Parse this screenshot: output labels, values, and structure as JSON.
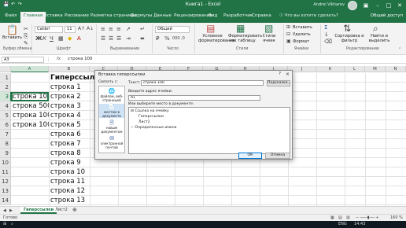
{
  "window": {
    "title": "Книга1 - Excel",
    "user": "Andrei Vikharev",
    "share": "Общий доступ"
  },
  "ribbon_tabs": [
    "Файл",
    "Главная",
    "Вставка",
    "Рисование",
    "Разметка страницы",
    "Формулы",
    "Данные",
    "Рецензирование",
    "Вид",
    "Разработчик",
    "Справка"
  ],
  "tell_me": "Что вы хотите сделать?",
  "ribbon": {
    "paste": "Вставить",
    "font_name": "Calibri",
    "font_size": "11",
    "number_format": "Общий",
    "conditional_formatting": "Условное форматирование",
    "format_as_table": "Форматировать как таблицу",
    "cell_styles": "Стили ячеек",
    "insert": "Вставить",
    "delete": "Удалить",
    "format": "Формат",
    "sort_filter": "Сортировка и фильтр",
    "find_select": "Найти и выделить",
    "groups": [
      "Буфер обмена",
      "Шрифт",
      "Выравнивание",
      "Число",
      "Стили",
      "Ячейки",
      "Редактирование"
    ]
  },
  "formula_bar": {
    "name_box": "A3",
    "fx": "fx",
    "content": "строка 100"
  },
  "columns": [
    "A",
    "B",
    "C",
    "D",
    "E",
    "F",
    "G",
    "H",
    "I",
    "J",
    "K",
    "L",
    "M",
    "N",
    "O"
  ],
  "rows": [
    "1",
    "2",
    "3",
    "4",
    "5",
    "6",
    "7",
    "8",
    "9",
    "10",
    "11",
    "12",
    "13",
    "14"
  ],
  "cells_a": [
    "",
    "",
    "строка 100",
    "строка 500",
    "строка 1000",
    "строка 10000",
    "",
    "",
    "",
    "",
    "",
    "",
    "",
    ""
  ],
  "cells_b": [
    "Гиперссылки",
    "строка 1",
    "строка 2",
    "строка 3",
    "строка 4",
    "строка 5",
    "строка 6",
    "строка 7",
    "строка 8",
    "строка 9",
    "строка 10",
    "строка 11",
    "строка 12",
    "строка 13"
  ],
  "sheets": {
    "active": "Гиперссылки",
    "other": "Лист2"
  },
  "status": {
    "ready": "Готово",
    "zoom": "160 %"
  },
  "taskbar": {
    "time": "14:43",
    "lang": "ENG"
  },
  "dialog": {
    "title": "Вставка гиперссылки",
    "help": "?",
    "close": "×",
    "link_to_label": "Связать с:",
    "text_label": "Текст:",
    "text_value": "строка 100",
    "screentip_btn": "Подсказка...",
    "address_label": "Введите адрес ячейки:",
    "address_value": "A1",
    "place_label": "Или выберите место в документе:",
    "link_items": [
      "файлом, веб-страницей",
      "местом в документе",
      "новым документом",
      "электронной почтой"
    ],
    "tree": [
      "Ссылка на ячейку",
      "Гиперссылки",
      "Лист2",
      "Определенные имена"
    ],
    "ok": "ОК",
    "cancel": "Отмена"
  },
  "colors": {
    "excel_green": "#217346",
    "ribbon_bg": "#f3f3f3",
    "selection": "#d3e5d9",
    "dialog_bg": "#f2f2f2"
  }
}
